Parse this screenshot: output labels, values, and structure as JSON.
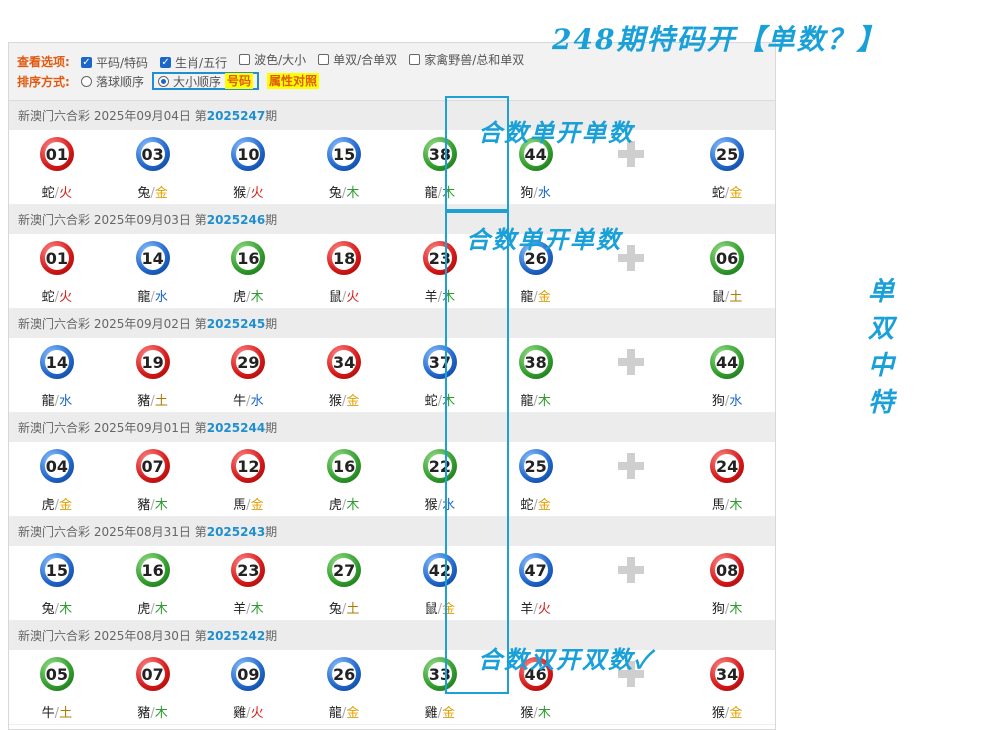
{
  "annotations": {
    "top": "248期特码开【单数？】",
    "note1": "合数单开单数",
    "note2": "合数单开单数",
    "note3": "合数双开双数✓",
    "side": "单双中特"
  },
  "options": {
    "view_label": "查看选项:",
    "view_items": [
      {
        "label": "平码/特码",
        "checked": true
      },
      {
        "label": "生肖/五行",
        "checked": true
      },
      {
        "label": "波色/大小",
        "checked": false
      },
      {
        "label": "单双/合单双",
        "checked": false
      },
      {
        "label": "家禽野兽/总和单双",
        "checked": false
      }
    ],
    "sort_label": "排序方式:",
    "sort_items": [
      {
        "label": "落球顺序",
        "checked": false
      },
      {
        "label": "大小顺序",
        "checked": true
      }
    ],
    "attr_btn1": "号码",
    "attr_btn2": "属性对照"
  },
  "draws": [
    {
      "header": "新澳门六合彩 2025年09月04日 第",
      "issue": "2025247",
      "suffix": "期",
      "balls": [
        {
          "num": "01",
          "color": "red",
          "zodiac": "蛇",
          "element": "火",
          "el": "fire"
        },
        {
          "num": "03",
          "color": "blue",
          "zodiac": "兔",
          "element": "金",
          "el": "metal"
        },
        {
          "num": "10",
          "color": "blue",
          "zodiac": "猴",
          "element": "火",
          "el": "fire"
        },
        {
          "num": "15",
          "color": "blue",
          "zodiac": "兔",
          "element": "木",
          "el": "wood"
        },
        {
          "num": "38",
          "color": "green",
          "zodiac": "龍",
          "element": "木",
          "el": "wood"
        },
        {
          "num": "44",
          "color": "green",
          "zodiac": "狗",
          "element": "水",
          "el": "water"
        },
        {
          "num": "25",
          "color": "blue",
          "zodiac": "蛇",
          "element": "金",
          "el": "metal"
        }
      ]
    },
    {
      "header": "新澳门六合彩 2025年09月03日 第",
      "issue": "2025246",
      "suffix": "期",
      "balls": [
        {
          "num": "01",
          "color": "red",
          "zodiac": "蛇",
          "element": "火",
          "el": "fire"
        },
        {
          "num": "14",
          "color": "blue",
          "zodiac": "龍",
          "element": "水",
          "el": "water"
        },
        {
          "num": "16",
          "color": "green",
          "zodiac": "虎",
          "element": "木",
          "el": "wood"
        },
        {
          "num": "18",
          "color": "red",
          "zodiac": "鼠",
          "element": "火",
          "el": "fire"
        },
        {
          "num": "23",
          "color": "red",
          "zodiac": "羊",
          "element": "木",
          "el": "wood"
        },
        {
          "num": "26",
          "color": "blue",
          "zodiac": "龍",
          "element": "金",
          "el": "metal"
        },
        {
          "num": "06",
          "color": "green",
          "zodiac": "鼠",
          "element": "土",
          "el": "earth"
        }
      ]
    },
    {
      "header": "新澳门六合彩 2025年09月02日 第",
      "issue": "2025245",
      "suffix": "期",
      "balls": [
        {
          "num": "14",
          "color": "blue",
          "zodiac": "龍",
          "element": "水",
          "el": "water"
        },
        {
          "num": "19",
          "color": "red",
          "zodiac": "豬",
          "element": "土",
          "el": "earth"
        },
        {
          "num": "29",
          "color": "red",
          "zodiac": "牛",
          "element": "水",
          "el": "water"
        },
        {
          "num": "34",
          "color": "red",
          "zodiac": "猴",
          "element": "金",
          "el": "metal"
        },
        {
          "num": "37",
          "color": "blue",
          "zodiac": "蛇",
          "element": "木",
          "el": "wood"
        },
        {
          "num": "38",
          "color": "green",
          "zodiac": "龍",
          "element": "木",
          "el": "wood"
        },
        {
          "num": "44",
          "color": "green",
          "zodiac": "狗",
          "element": "水",
          "el": "water"
        }
      ]
    },
    {
      "header": "新澳门六合彩 2025年09月01日 第",
      "issue": "2025244",
      "suffix": "期",
      "balls": [
        {
          "num": "04",
          "color": "blue",
          "zodiac": "虎",
          "element": "金",
          "el": "metal"
        },
        {
          "num": "07",
          "color": "red",
          "zodiac": "豬",
          "element": "木",
          "el": "wood"
        },
        {
          "num": "12",
          "color": "red",
          "zodiac": "馬",
          "element": "金",
          "el": "metal"
        },
        {
          "num": "16",
          "color": "green",
          "zodiac": "虎",
          "element": "木",
          "el": "wood"
        },
        {
          "num": "22",
          "color": "green",
          "zodiac": "猴",
          "element": "水",
          "el": "water"
        },
        {
          "num": "25",
          "color": "blue",
          "zodiac": "蛇",
          "element": "金",
          "el": "metal"
        },
        {
          "num": "24",
          "color": "red",
          "zodiac": "馬",
          "element": "木",
          "el": "wood"
        }
      ]
    },
    {
      "header": "新澳门六合彩 2025年08月31日 第",
      "issue": "2025243",
      "suffix": "期",
      "balls": [
        {
          "num": "15",
          "color": "blue",
          "zodiac": "兔",
          "element": "木",
          "el": "wood"
        },
        {
          "num": "16",
          "color": "green",
          "zodiac": "虎",
          "element": "木",
          "el": "wood"
        },
        {
          "num": "23",
          "color": "red",
          "zodiac": "羊",
          "element": "木",
          "el": "wood"
        },
        {
          "num": "27",
          "color": "green",
          "zodiac": "兔",
          "element": "土",
          "el": "earth"
        },
        {
          "num": "42",
          "color": "blue",
          "zodiac": "鼠",
          "element": "金",
          "el": "metal"
        },
        {
          "num": "47",
          "color": "blue",
          "zodiac": "羊",
          "element": "火",
          "el": "fire"
        },
        {
          "num": "08",
          "color": "red",
          "zodiac": "狗",
          "element": "木",
          "el": "wood"
        }
      ]
    },
    {
      "header": "新澳门六合彩 2025年08月30日 第",
      "issue": "2025242",
      "suffix": "期",
      "balls": [
        {
          "num": "05",
          "color": "green",
          "zodiac": "牛",
          "element": "土",
          "el": "earth"
        },
        {
          "num": "07",
          "color": "red",
          "zodiac": "豬",
          "element": "木",
          "el": "wood"
        },
        {
          "num": "09",
          "color": "blue",
          "zodiac": "雞",
          "element": "火",
          "el": "fire"
        },
        {
          "num": "26",
          "color": "blue",
          "zodiac": "龍",
          "element": "金",
          "el": "metal"
        },
        {
          "num": "33",
          "color": "green",
          "zodiac": "雞",
          "element": "金",
          "el": "metal"
        },
        {
          "num": "46",
          "color": "red",
          "zodiac": "猴",
          "element": "木",
          "el": "wood"
        },
        {
          "num": "34",
          "color": "red",
          "zodiac": "猴",
          "element": "金",
          "el": "metal"
        }
      ]
    }
  ]
}
